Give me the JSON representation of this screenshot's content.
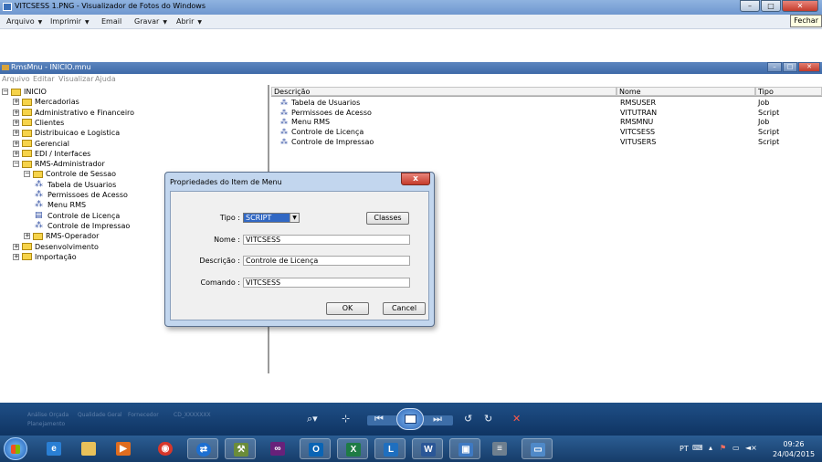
{
  "viewer": {
    "title": "VITCSESS 1.PNG - Visualizador de Fotos do Windows",
    "menu": [
      "Arquivo",
      "Imprimir",
      "Email",
      "Gravar",
      "Abrir"
    ],
    "tooltip": "Fechar",
    "toolbar_ghost_text": [
      "Análise Orçada",
      "Qualidade Geral",
      "Fornecedor",
      "Planejamento",
      "CD_XXXXXXX"
    ]
  },
  "app": {
    "title": "RmsMnu - INICIO.mnu",
    "menu": [
      "Arquivo",
      "Editar",
      "Visualizar",
      "Ajuda"
    ]
  },
  "tree": [
    {
      "label": "INICIO",
      "level": 0,
      "kind": "folder",
      "exp": "−"
    },
    {
      "label": "Mercadorias",
      "level": 1,
      "kind": "folder",
      "exp": "+"
    },
    {
      "label": "Administrativo e Financeiro",
      "level": 1,
      "kind": "folder",
      "exp": "+"
    },
    {
      "label": "Clientes",
      "level": 1,
      "kind": "folder",
      "exp": "+"
    },
    {
      "label": "Distribuicao e Logistica",
      "level": 1,
      "kind": "folder",
      "exp": "+"
    },
    {
      "label": "Gerencial",
      "level": 1,
      "kind": "folder",
      "exp": "+"
    },
    {
      "label": "EDI / Interfaces",
      "level": 1,
      "kind": "folder",
      "exp": "+"
    },
    {
      "label": "RMS-Administrador",
      "level": 1,
      "kind": "folder",
      "exp": "−"
    },
    {
      "label": "Controle de Sessao",
      "level": 2,
      "kind": "folder",
      "exp": "−"
    },
    {
      "label": "Tabela de Usuarios",
      "level": 3,
      "kind": "leaf"
    },
    {
      "label": "Permissoes de Acesso",
      "level": 3,
      "kind": "leaf"
    },
    {
      "label": "Menu RMS",
      "level": 3,
      "kind": "leaf"
    },
    {
      "label": "Controle de Licença",
      "level": 3,
      "kind": "leaf-alt"
    },
    {
      "label": "Controle de Impressao",
      "level": 3,
      "kind": "leaf"
    },
    {
      "label": "RMS-Operador",
      "level": 2,
      "kind": "folder",
      "exp": "+"
    },
    {
      "label": "Desenvolvimento",
      "level": 1,
      "kind": "folder",
      "exp": "+"
    },
    {
      "label": "Importação",
      "level": 1,
      "kind": "folder",
      "exp": "+"
    }
  ],
  "list": {
    "headers": [
      "Descrição",
      "Nome",
      "Tipo"
    ],
    "rows": [
      {
        "desc": "Tabela de Usuarios",
        "nome": "RMSUSER",
        "tipo": "Job"
      },
      {
        "desc": "Permissoes de Acesso",
        "nome": "VITUTRAN",
        "tipo": "Script"
      },
      {
        "desc": "Menu RMS",
        "nome": "RMSMNU",
        "tipo": "Job"
      },
      {
        "desc": "Controle de Licença",
        "nome": "VITCSESS",
        "tipo": "Script"
      },
      {
        "desc": "Controle de Impressao",
        "nome": "VITUSERS",
        "tipo": "Script"
      }
    ]
  },
  "dialog": {
    "title": "Propriedades do Item de Menu",
    "close": "x",
    "tipo_label": "Tipo :",
    "tipo_value": "SCRIPT",
    "classes_button": "Classes",
    "nome_label": "Nome :",
    "nome_value": "VITCSESS",
    "descricao_label": "Descrição :",
    "descricao_value": "Controle de Licença",
    "comando_label": "Comando :",
    "comando_value": "VITCSESS",
    "ok_button": "OK",
    "cancel_button": "Cancel"
  },
  "tray": {
    "lang": "PT",
    "time": "09:26",
    "date": "24/04/2015"
  },
  "colors": {
    "dialog_frame": "#c2d6ee",
    "selection": "#3168c4",
    "toolbar": "#1f4f86",
    "taskbar": "#2b5d93"
  }
}
